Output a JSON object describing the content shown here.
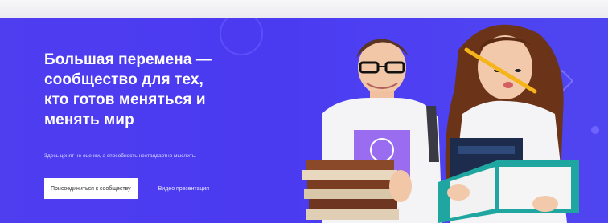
{
  "hero": {
    "headline": "Большая перемена —\nсообщество для тех,\nкто готов меняться и\nменять мир",
    "subtitle": "Здесь ценят не оценки, а способность нестандартно мыслить.",
    "join_button": "Присоединиться к сообществу",
    "video_link": "Видео презентация"
  },
  "colors": {
    "banner": "#4f3df0",
    "text_on_banner": "#ffffff",
    "button_bg": "#ffffff",
    "book_teal": "#1fa6a0",
    "pencil": "#f4b41a"
  }
}
